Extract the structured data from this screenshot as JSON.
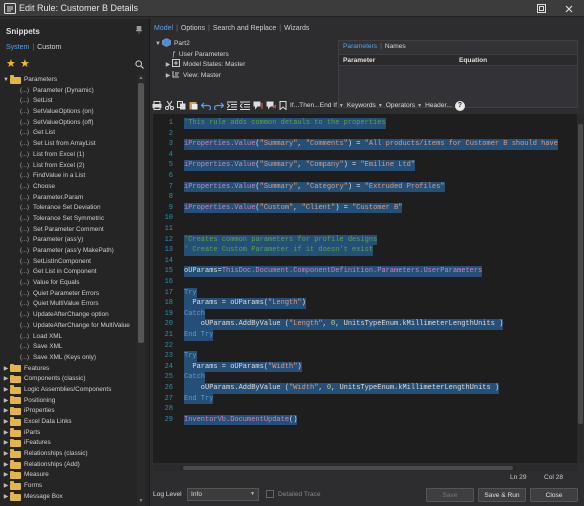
{
  "window": {
    "title": "Edit Rule: Customer B Details"
  },
  "snippets": {
    "header": "Snippets",
    "tabs": [
      "System",
      "Custom"
    ],
    "tree": [
      {
        "label": "Parameters",
        "type": "folder",
        "expanded": true
      },
      {
        "label": "Parameter (Dynamic)",
        "type": "snippet"
      },
      {
        "label": "SetList",
        "type": "snippet"
      },
      {
        "label": "SetValueOptions (on)",
        "type": "snippet"
      },
      {
        "label": "SetValueOptions (off)",
        "type": "snippet"
      },
      {
        "label": "Get List",
        "type": "snippet"
      },
      {
        "label": "Set List from ArrayList",
        "type": "snippet"
      },
      {
        "label": "List from Excel (1)",
        "type": "snippet"
      },
      {
        "label": "List from Excel (2)",
        "type": "snippet"
      },
      {
        "label": "FindValue in a List",
        "type": "snippet"
      },
      {
        "label": "Choose",
        "type": "snippet"
      },
      {
        "label": "Parameter.Param",
        "type": "snippet"
      },
      {
        "label": "Tolerance Set Deviation",
        "type": "snippet"
      },
      {
        "label": "Tolerance Set Symmetric",
        "type": "snippet"
      },
      {
        "label": "Set Parameter Comment",
        "type": "snippet"
      },
      {
        "label": "Parameter (ass'y)",
        "type": "snippet"
      },
      {
        "label": "Parameter (ass'y MakePath)",
        "type": "snippet"
      },
      {
        "label": "SetListInComponent",
        "type": "snippet"
      },
      {
        "label": "Get List in Component",
        "type": "snippet"
      },
      {
        "label": "Value for Equals",
        "type": "snippet"
      },
      {
        "label": "Quiet Parameter Errors",
        "type": "snippet"
      },
      {
        "label": "Quiet MultiValue Errors",
        "type": "snippet"
      },
      {
        "label": "UpdateAfterChange option",
        "type": "snippet"
      },
      {
        "label": "UpdateAfterChange for MultiValue",
        "type": "snippet"
      },
      {
        "label": "Load XML",
        "type": "snippet"
      },
      {
        "label": "Save XML",
        "type": "snippet"
      },
      {
        "label": "Save XML (Keys only)",
        "type": "snippet"
      },
      {
        "label": "Features",
        "type": "folder",
        "expanded": false
      },
      {
        "label": "Components (classic)",
        "type": "folder",
        "expanded": false
      },
      {
        "label": "Logic Assemblies/Components",
        "type": "folder",
        "expanded": false
      },
      {
        "label": "Positioning",
        "type": "folder",
        "expanded": false
      },
      {
        "label": "iProperties",
        "type": "folder",
        "expanded": false
      },
      {
        "label": "Excel Data Links",
        "type": "folder",
        "expanded": false
      },
      {
        "label": "iParts",
        "type": "folder",
        "expanded": false
      },
      {
        "label": "iFeatures",
        "type": "folder",
        "expanded": false
      },
      {
        "label": "Relationships (classic)",
        "type": "folder",
        "expanded": false
      },
      {
        "label": "Relationships (Add)",
        "type": "folder",
        "expanded": false
      },
      {
        "label": "Measure",
        "type": "folder",
        "expanded": false
      },
      {
        "label": "Forms",
        "type": "folder",
        "expanded": false
      },
      {
        "label": "Message Box",
        "type": "folder",
        "expanded": false
      }
    ]
  },
  "top_tabs": [
    "Model",
    "Options",
    "Search and Replace",
    "Wizards"
  ],
  "model_tree": [
    {
      "label": "Part2",
      "level": 0,
      "arrow": "▼"
    },
    {
      "label": "User Parameters",
      "level": 1,
      "arrow": ""
    },
    {
      "label": "Model States: Master",
      "level": 1,
      "arrow": "▶"
    },
    {
      "label": "View: Master",
      "level": 1,
      "arrow": "▶"
    }
  ],
  "param_pane": {
    "tabs": [
      "Parameters",
      "Names"
    ],
    "columns": [
      "Parameter",
      "Equation"
    ]
  },
  "toolbar": {
    "if_then": "If...Then...End If",
    "keywords": "Keywords",
    "operators": "Operators",
    "header": "Header...",
    "help": "?"
  },
  "code_lines": [
    {
      "n": "1",
      "sel": true,
      "parts": [
        {
          "t": "'This rule adds common detauls to the properties",
          "c": "com"
        }
      ]
    },
    {
      "n": "2",
      "sel": false,
      "parts": []
    },
    {
      "n": "3",
      "sel": true,
      "parts": [
        {
          "t": "iProperties.Value",
          "c": "prop"
        },
        {
          "t": "(",
          "c": "pl"
        },
        {
          "t": "\"Summary\"",
          "c": "str"
        },
        {
          "t": ", ",
          "c": "pl"
        },
        {
          "t": "\"Comments\"",
          "c": "str"
        },
        {
          "t": ") = ",
          "c": "pl"
        },
        {
          "t": "\"All products/items for Customer B should have",
          "c": "str"
        }
      ]
    },
    {
      "n": "4",
      "sel": false,
      "parts": []
    },
    {
      "n": "5",
      "sel": true,
      "parts": [
        {
          "t": "iProperties.Value",
          "c": "prop"
        },
        {
          "t": "(",
          "c": "pl"
        },
        {
          "t": "\"Summary\"",
          "c": "str"
        },
        {
          "t": ", ",
          "c": "pl"
        },
        {
          "t": "\"Company\"",
          "c": "str"
        },
        {
          "t": ") = ",
          "c": "pl"
        },
        {
          "t": "\"Emiline Ltd\"",
          "c": "str"
        }
      ]
    },
    {
      "n": "6",
      "sel": false,
      "parts": []
    },
    {
      "n": "7",
      "sel": true,
      "parts": [
        {
          "t": "iProperties.Value",
          "c": "prop"
        },
        {
          "t": "(",
          "c": "pl"
        },
        {
          "t": "\"Summary\"",
          "c": "str"
        },
        {
          "t": ", ",
          "c": "pl"
        },
        {
          "t": "\"Category\"",
          "c": "str"
        },
        {
          "t": ") = ",
          "c": "pl"
        },
        {
          "t": "\"Extruded Profiles\"",
          "c": "str"
        }
      ]
    },
    {
      "n": "8",
      "sel": false,
      "parts": []
    },
    {
      "n": "9",
      "sel": true,
      "parts": [
        {
          "t": "iProperties.Value",
          "c": "prop"
        },
        {
          "t": "(",
          "c": "pl"
        },
        {
          "t": "\"Custom\"",
          "c": "str"
        },
        {
          "t": ", ",
          "c": "pl"
        },
        {
          "t": "\"Client\"",
          "c": "str"
        },
        {
          "t": ") = ",
          "c": "pl"
        },
        {
          "t": "\"Customer B\"",
          "c": "str"
        }
      ]
    },
    {
      "n": "10",
      "sel": false,
      "parts": []
    },
    {
      "n": "11",
      "sel": false,
      "parts": []
    },
    {
      "n": "12",
      "sel": true,
      "parts": [
        {
          "t": "'Creates common parameters for profile designs",
          "c": "com"
        }
      ]
    },
    {
      "n": "13",
      "sel": true,
      "parts": [
        {
          "t": "' Create Custom Parameter if it doesn't exist",
          "c": "com"
        }
      ]
    },
    {
      "n": "14",
      "sel": false,
      "parts": []
    },
    {
      "n": "15",
      "sel": true,
      "parts": [
        {
          "t": "oUParams=",
          "c": "pl"
        },
        {
          "t": "ThisDoc.Document.ComponentDefinition.Parameters.UserParameters",
          "c": "prop"
        }
      ]
    },
    {
      "n": "16",
      "sel": false,
      "parts": []
    },
    {
      "n": "17",
      "sel": true,
      "parts": [
        {
          "t": "Try",
          "c": "kw"
        }
      ]
    },
    {
      "n": "18",
      "sel": true,
      "parts": [
        {
          "t": "  Params = oUParams(",
          "c": "pl"
        },
        {
          "t": "\"Length\"",
          "c": "str"
        },
        {
          "t": ")",
          "c": "pl"
        }
      ]
    },
    {
      "n": "19",
      "sel": true,
      "parts": [
        {
          "t": "Catch",
          "c": "kw"
        }
      ]
    },
    {
      "n": "20",
      "sel": true,
      "parts": [
        {
          "t": "    oUParams.AddByValue (",
          "c": "pl"
        },
        {
          "t": "\"Length\"",
          "c": "str"
        },
        {
          "t": ", ",
          "c": "pl"
        },
        {
          "t": "0",
          "c": "num"
        },
        {
          "t": ", UnitsTypeEnum.kMillimeterLengthUnits )",
          "c": "pl"
        }
      ]
    },
    {
      "n": "21",
      "sel": true,
      "parts": [
        {
          "t": "End Try",
          "c": "kw"
        }
      ]
    },
    {
      "n": "22",
      "sel": false,
      "parts": []
    },
    {
      "n": "23",
      "sel": true,
      "parts": [
        {
          "t": "Try",
          "c": "kw"
        }
      ]
    },
    {
      "n": "24",
      "sel": true,
      "parts": [
        {
          "t": "  Params = oUParams(",
          "c": "pl"
        },
        {
          "t": "\"Width\"",
          "c": "str"
        },
        {
          "t": ")",
          "c": "pl"
        }
      ]
    },
    {
      "n": "25",
      "sel": true,
      "parts": [
        {
          "t": "Catch",
          "c": "kw"
        }
      ]
    },
    {
      "n": "26",
      "sel": true,
      "parts": [
        {
          "t": "    oUParams.AddByValue (",
          "c": "pl"
        },
        {
          "t": "\"Width\"",
          "c": "str"
        },
        {
          "t": ", ",
          "c": "pl"
        },
        {
          "t": "0",
          "c": "num"
        },
        {
          "t": ", UnitsTypeEnum.kMillimeterLengthUnits )",
          "c": "pl"
        }
      ]
    },
    {
      "n": "27",
      "sel": true,
      "parts": [
        {
          "t": "End Try",
          "c": "kw"
        }
      ]
    },
    {
      "n": "28",
      "sel": false,
      "parts": []
    },
    {
      "n": "29",
      "sel": true,
      "parts": [
        {
          "t": "InventorVb.DocumentUpdate",
          "c": "prop"
        },
        {
          "t": "()",
          "c": "pl"
        }
      ]
    }
  ],
  "status": {
    "line": "Ln 29",
    "col": "Col 28"
  },
  "bottom": {
    "log_level_label": "Log Level",
    "log_level_value": "Info",
    "detailed_trace": "Detailed Trace",
    "save": "Save",
    "save_run": "Save & Run",
    "close": "Close"
  },
  "colors": {
    "folder": "#e2b64a",
    "accent": "#5aa0e8",
    "selection": "#264f78"
  }
}
